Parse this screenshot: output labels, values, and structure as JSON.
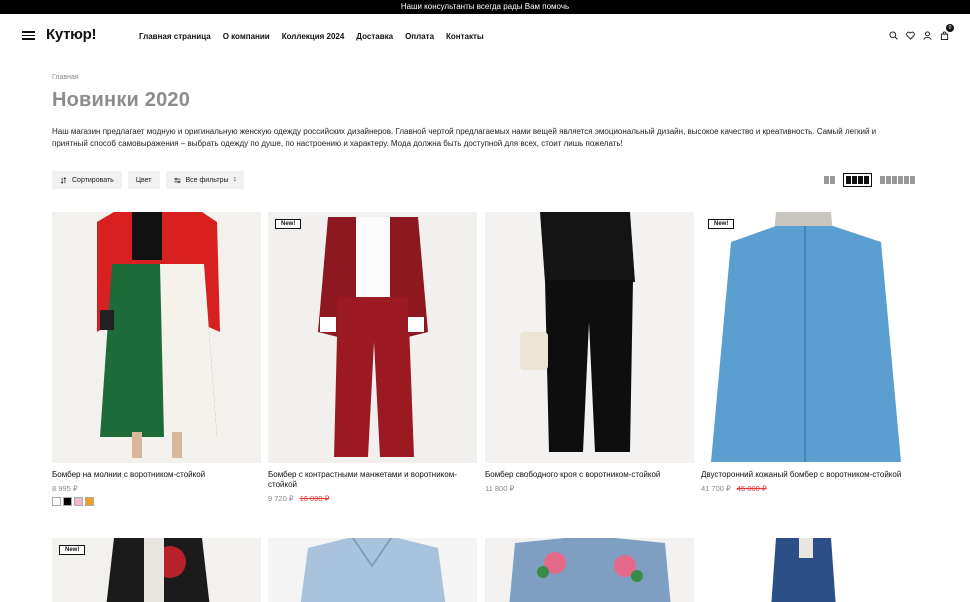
{
  "topbar": {
    "text": "Наши консультанты всегда рады Вам помочь"
  },
  "header": {
    "logo": "Кутюр!",
    "nav": [
      "Главная страница",
      "О компании",
      "Коллекция 2024",
      "Доставка",
      "Оплата",
      "Контакты"
    ],
    "icons": [
      "search-icon",
      "heart-icon",
      "user-icon",
      "bag-icon"
    ],
    "cart_count": "0"
  },
  "breadcrumb": "Главная",
  "page_title": "Новинки 2020",
  "description": "Наш магазин предлагает модную и оригинальную женскую одежду российских дизайнеров. Главной чертой предлагаемых нами вещей является эмоциональный дизайн, высокое качество и креативность. Самый легкий и приятный способ самовыражения – выбрать одежду по душе, по настроению и характеру. Мода должна быть доступной для всех, стоит лишь пожелать!",
  "filters": {
    "sort": "Сортировать",
    "color": "Цвет",
    "all": "Все фильтры",
    "all_count": "1"
  },
  "view_options": [
    "grid-2",
    "grid-4",
    "grid-6"
  ],
  "new_label": "New!",
  "products": [
    {
      "name": "Бомбер на молнии с воротником-стойкой",
      "price": "8 995 ₽",
      "old_price": "",
      "new": false,
      "swatches": [
        "#ffffff",
        "#000000",
        "#f4b6c8",
        "#f0a020"
      ]
    },
    {
      "name": "Бомбер с контрастными манжетами и воротником-стойкой",
      "price": "9 720 ₽",
      "old_price": "16 000 ₽",
      "new": true
    },
    {
      "name": "Бомбер свободного кроя с воротником-стойкой",
      "price": "11 800 ₽",
      "old_price": "",
      "new": false
    },
    {
      "name": "Двусторонний кожаный бомбер с воротником-стойкой",
      "price": "41 700 ₽",
      "old_price": "45 000 ₽",
      "new": true
    }
  ],
  "second_row": [
    {
      "new": true
    },
    {
      "new": false
    },
    {
      "new": false
    },
    {
      "new": false
    }
  ],
  "colors": {
    "accent_sale": "#ee3333",
    "title_gray": "#8c8c8c"
  }
}
